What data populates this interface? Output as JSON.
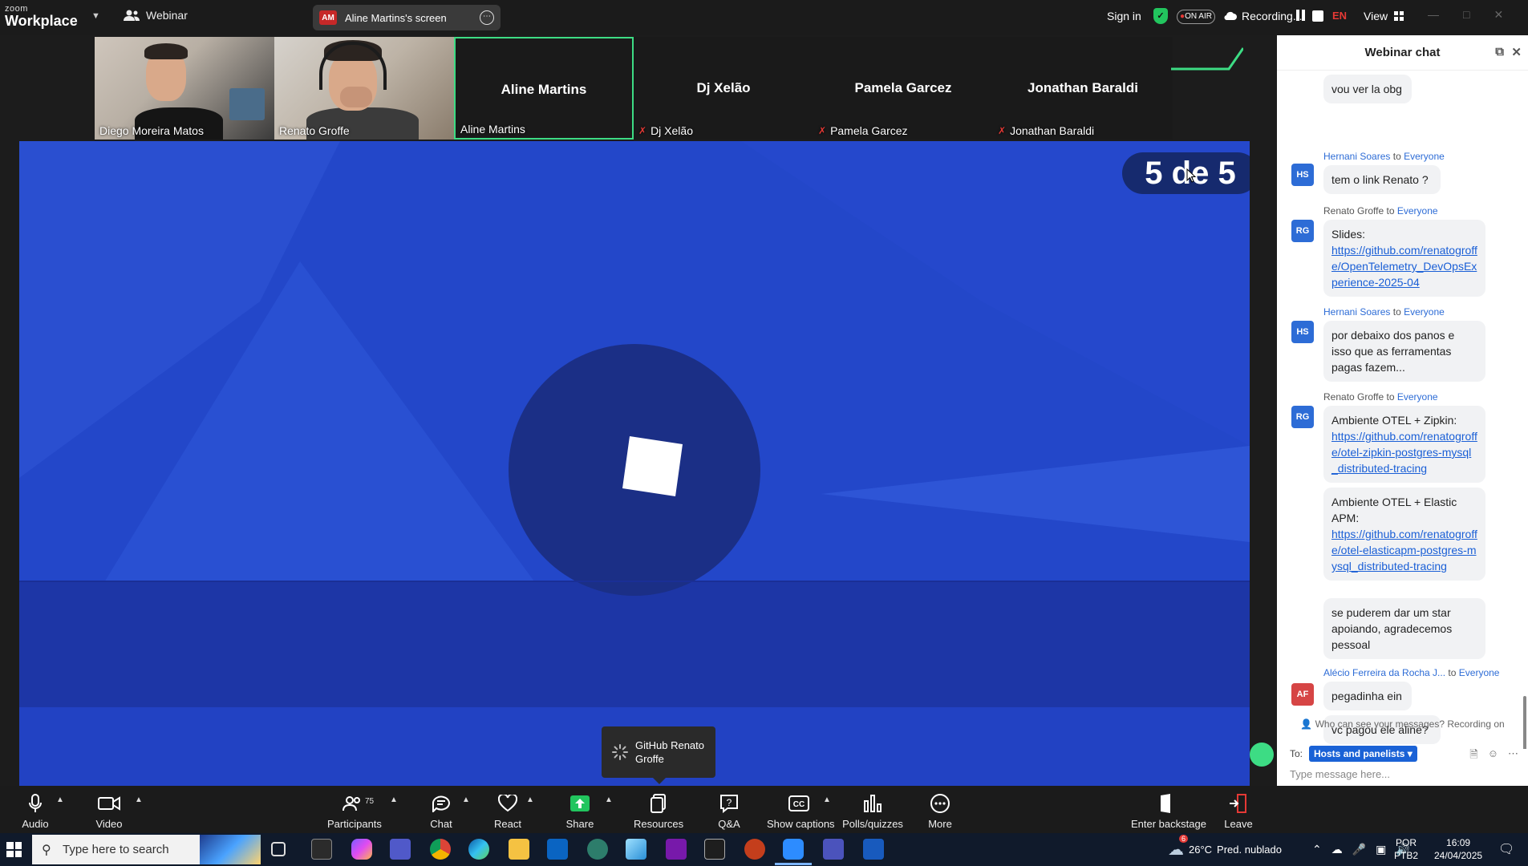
{
  "app": {
    "brand_small": "zoom",
    "brand_name": "Workplace",
    "mode_label": "Webinar",
    "screen_label": "Aline Martins's screen",
    "screen_badge": "AM",
    "sign_in": "Sign in",
    "on_air": "ON AIR",
    "recording": "Recording...",
    "language": "EN",
    "view": "View"
  },
  "participants": [
    {
      "name": "Diego Moreira Matos",
      "video": true,
      "muted": false
    },
    {
      "name": "Renato Groffe",
      "video": true,
      "muted": false
    },
    {
      "name": "Aline Martins",
      "video": false,
      "muted": false,
      "active": true
    },
    {
      "name": "Dj Xelão",
      "video": false,
      "muted": true
    },
    {
      "name": "Pamela Garcez",
      "video": false,
      "muted": true
    },
    {
      "name": "Jonathan Baraldi",
      "video": false,
      "muted": true
    }
  ],
  "shared_screen": {
    "slide_counter": "5 de 5",
    "tooltip": "GitHub Renato Groffe",
    "colors": {
      "bg": "#2244c6",
      "dark_band": "#1c35a8",
      "circle": "#1b2f86"
    }
  },
  "chat": {
    "title": "Webinar chat",
    "to_word": "to",
    "messages": [
      {
        "sender": "",
        "to": "",
        "avatar": "",
        "text": "vou ver la obg"
      },
      {
        "sender": "Hernani Soares",
        "to": "Everyone",
        "avatar": "HS",
        "avatar_color": "#2d6cd6",
        "text": "tem o link Renato ?"
      },
      {
        "sender": "Renato Groffe",
        "to": "Everyone",
        "avatar": "RG",
        "avatar_color": "#2d6cd6",
        "text": "Slides:",
        "link": "https://github.com/renatogroffe/OpenTelemetry_DevOpsExperience-2025-04"
      },
      {
        "sender": "Hernani Soares",
        "to": "Everyone",
        "avatar": "HS",
        "avatar_color": "#2d6cd6",
        "text": "por debaixo dos panos e isso que as ferramentas pagas fazem..."
      },
      {
        "sender": "Renato Groffe",
        "to": "Everyone",
        "avatar": "RG",
        "avatar_color": "#2d6cd6",
        "text": "Ambiente OTEL + Zipkin:",
        "link": "https://github.com/renatogroffe/otel-zipkin-postgres-mysql_distributed-tracing"
      },
      {
        "sender": "",
        "to": "",
        "avatar": "",
        "text": "Ambiente OTEL + Elastic APM:",
        "link": "https://github.com/renatogroffe/otel-elasticapm-postgres-mysql_distributed-tracing"
      },
      {
        "sender": "",
        "to": "",
        "avatar": "",
        "text": "se puderem dar um star apoiando, agradecemos pessoal"
      },
      {
        "sender": "Alécio Ferreira da Rocha J...",
        "to": "Everyone",
        "avatar": "AF",
        "avatar_color": "#d64545",
        "text": "pegadinha ein"
      },
      {
        "sender": "",
        "to": "",
        "avatar": "",
        "text": "vc pagou ele aline?"
      }
    ],
    "notice": "Who can see your messages? Recording on",
    "to_label": "To:",
    "to_value": "Hosts and panelists",
    "placeholder": "Type message here..."
  },
  "toolbar": {
    "audio": "Audio",
    "video": "Video",
    "participants": "Participants",
    "participants_count": "75",
    "chat": "Chat",
    "react": "React",
    "share": "Share",
    "resources": "Resources",
    "qa": "Q&A",
    "captions": "Show captions",
    "polls": "Polls/quizzes",
    "more": "More",
    "backstage": "Enter backstage",
    "leave": "Leave"
  },
  "taskbar": {
    "search_placeholder": "Type here to search",
    "weather_temp": "26°C",
    "weather_desc": "Pred. nublado",
    "kbd_lang": "POR",
    "kbd_layout": "PTB2",
    "time": "16:09",
    "date": "24/04/2025",
    "notification_badge": "6"
  }
}
